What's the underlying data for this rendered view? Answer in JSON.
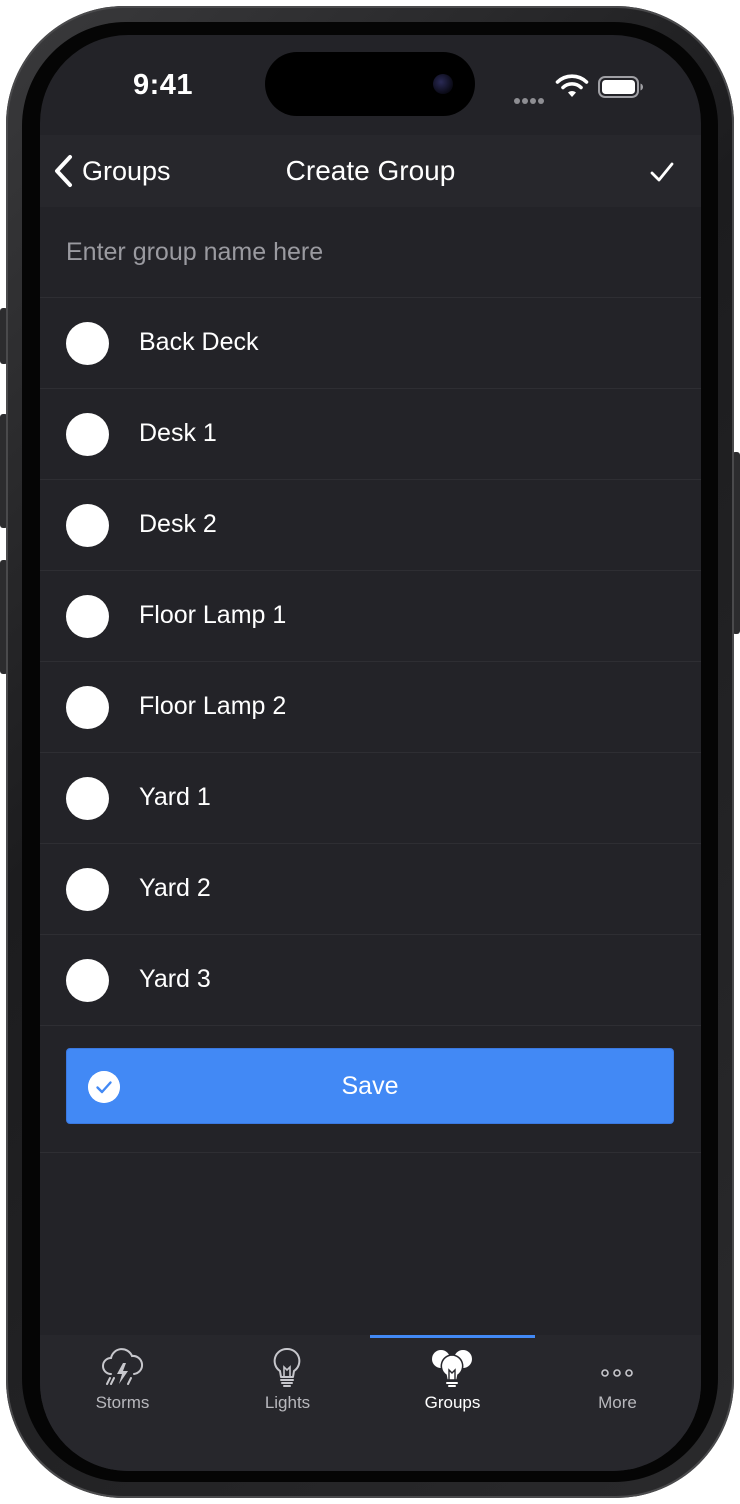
{
  "status_bar": {
    "time": "9:41"
  },
  "nav": {
    "back_label": "Groups",
    "title": "Create Group"
  },
  "name_field": {
    "placeholder": "Enter group name here",
    "value": ""
  },
  "lights": [
    {
      "label": "Back Deck",
      "selected": false
    },
    {
      "label": "Desk 1",
      "selected": false
    },
    {
      "label": "Desk 2",
      "selected": false
    },
    {
      "label": "Floor Lamp 1",
      "selected": false
    },
    {
      "label": "Floor Lamp 2",
      "selected": false
    },
    {
      "label": "Yard 1",
      "selected": false
    },
    {
      "label": "Yard 2",
      "selected": false
    },
    {
      "label": "Yard 3",
      "selected": false
    }
  ],
  "save": {
    "label": "Save"
  },
  "tabs": [
    {
      "label": "Storms",
      "icon": "storm-cloud-icon",
      "active": false
    },
    {
      "label": "Lights",
      "icon": "lightbulb-icon",
      "active": false
    },
    {
      "label": "Groups",
      "icon": "multi-lightbulb-icon",
      "active": true
    },
    {
      "label": "More",
      "icon": "ellipsis-icon",
      "active": false
    }
  ],
  "colors": {
    "background": "#232328",
    "bar": "#27272c",
    "accent": "#4289f5",
    "divider": "#2e2e33"
  }
}
